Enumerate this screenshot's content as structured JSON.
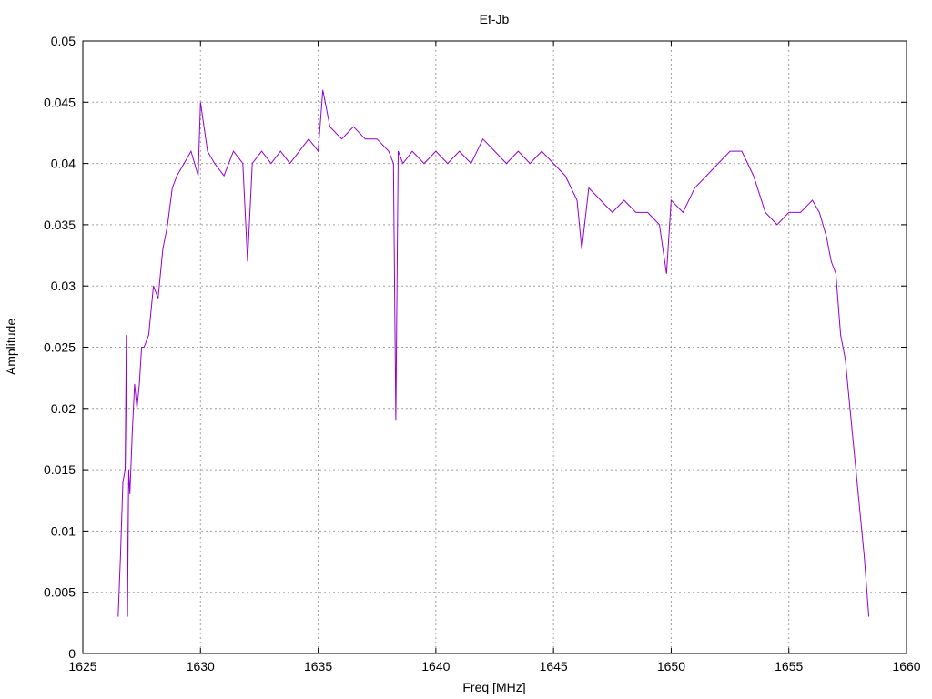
{
  "chart_data": {
    "type": "line",
    "title": "Ef-Jb",
    "xlabel": "Freq [MHz]",
    "ylabel": "Amplitude",
    "xlim": [
      1625,
      1660
    ],
    "ylim": [
      0,
      0.05
    ],
    "x_ticks": [
      "1625",
      "1630",
      "1635",
      "1640",
      "1645",
      "1650",
      "1655",
      "1660"
    ],
    "y_ticks": [
      "0",
      "0.005",
      "0.01",
      "0.015",
      "0.02",
      "0.025",
      "0.03",
      "0.035",
      "0.04",
      "0.045",
      "0.05"
    ],
    "grid": true,
    "line_color": "#9400d3",
    "series": [
      {
        "x": [
          1626.5,
          1626.6,
          1626.7,
          1626.8,
          1626.85,
          1626.9,
          1626.95,
          1627.0,
          1627.1,
          1627.2,
          1627.3,
          1627.4,
          1627.5,
          1627.6,
          1627.8,
          1628.0,
          1628.2,
          1628.4,
          1628.6,
          1628.8,
          1629.0,
          1629.3,
          1629.6,
          1629.9,
          1630.0,
          1630.3,
          1630.6,
          1631.0,
          1631.4,
          1631.8,
          1632.0,
          1632.2,
          1632.6,
          1633.0,
          1633.4,
          1633.8,
          1634.2,
          1634.6,
          1635.0,
          1635.2,
          1635.5,
          1636.0,
          1636.5,
          1637.0,
          1637.5,
          1638.0,
          1638.2,
          1638.3,
          1638.4,
          1638.6,
          1639.0,
          1639.5,
          1640.0,
          1640.5,
          1641.0,
          1641.5,
          1642.0,
          1642.5,
          1643.0,
          1643.5,
          1644.0,
          1644.5,
          1645.0,
          1645.5,
          1646.0,
          1646.2,
          1646.5,
          1647.0,
          1647.5,
          1648.0,
          1648.5,
          1649.0,
          1649.5,
          1649.8,
          1650.0,
          1650.5,
          1651.0,
          1651.5,
          1652.0,
          1652.5,
          1653.0,
          1653.5,
          1654.0,
          1654.5,
          1655.0,
          1655.5,
          1656.0,
          1656.3,
          1656.6,
          1656.8,
          1657.0,
          1657.2,
          1657.4,
          1657.6,
          1657.8,
          1658.0,
          1658.2,
          1658.4
        ],
        "y": [
          0.003,
          0.008,
          0.014,
          0.015,
          0.026,
          0.003,
          0.015,
          0.013,
          0.018,
          0.022,
          0.02,
          0.022,
          0.025,
          0.025,
          0.026,
          0.03,
          0.029,
          0.033,
          0.035,
          0.038,
          0.039,
          0.04,
          0.041,
          0.039,
          0.045,
          0.041,
          0.04,
          0.039,
          0.041,
          0.04,
          0.032,
          0.04,
          0.041,
          0.04,
          0.041,
          0.04,
          0.041,
          0.042,
          0.041,
          0.046,
          0.043,
          0.042,
          0.043,
          0.042,
          0.042,
          0.041,
          0.04,
          0.019,
          0.041,
          0.04,
          0.041,
          0.04,
          0.041,
          0.04,
          0.041,
          0.04,
          0.042,
          0.041,
          0.04,
          0.041,
          0.04,
          0.041,
          0.04,
          0.039,
          0.037,
          0.033,
          0.038,
          0.037,
          0.036,
          0.037,
          0.036,
          0.036,
          0.035,
          0.031,
          0.037,
          0.036,
          0.038,
          0.039,
          0.04,
          0.041,
          0.041,
          0.039,
          0.036,
          0.035,
          0.036,
          0.036,
          0.037,
          0.036,
          0.034,
          0.032,
          0.031,
          0.026,
          0.024,
          0.02,
          0.016,
          0.012,
          0.008,
          0.003
        ]
      }
    ]
  }
}
